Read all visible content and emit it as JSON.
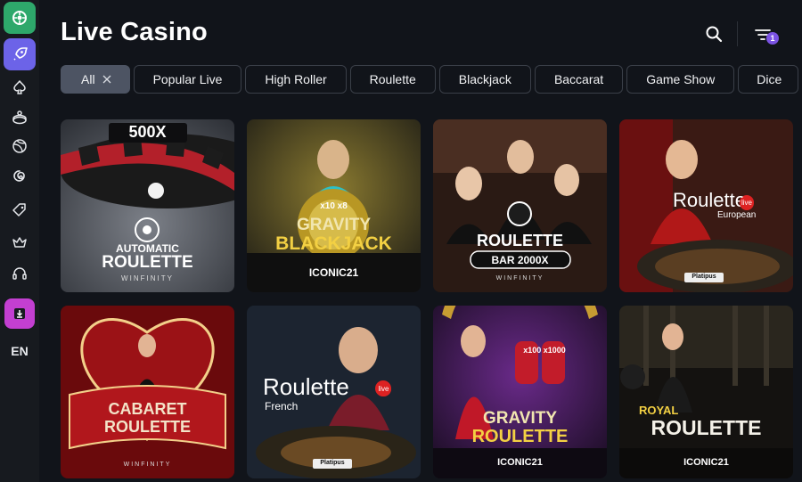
{
  "page": {
    "title": "Live Casino"
  },
  "header": {
    "filter_badge": "1"
  },
  "sidebar": {
    "items": [
      {
        "icon": "logo-icon"
      },
      {
        "icon": "rocket-icon"
      },
      {
        "icon": "spade-icon"
      },
      {
        "icon": "slot-machine-icon"
      },
      {
        "icon": "sports-ball-icon"
      },
      {
        "icon": "spiral-icon"
      },
      {
        "icon": "tag-icon"
      },
      {
        "icon": "crown-icon"
      },
      {
        "icon": "headset-icon"
      },
      {
        "icon": "download-icon"
      }
    ],
    "language": "EN"
  },
  "filters": [
    "All",
    "Popular Live",
    "High Roller",
    "Roulette",
    "Blackjack",
    "Baccarat",
    "Game Show",
    "Dice"
  ],
  "games": [
    {
      "top": "500X",
      "line1": "AUTOMATIC",
      "line2": "ROULETTE",
      "provider": "WINFINITY"
    },
    {
      "top": "x10  x8",
      "line1": "GRAVITY",
      "line2": "BLACKJACK",
      "provider": "ICONIC21"
    },
    {
      "line1": "ROULETTE",
      "line2": "BAR 2000X",
      "provider": "WINFINITY"
    },
    {
      "line1": "Roulette",
      "badge": "live",
      "line2": "European",
      "provider": "Platipus"
    },
    {
      "line1": "CABARET",
      "line2": "ROULETTE",
      "provider": "WINFINITY"
    },
    {
      "line1": "Roulette",
      "badge": "live",
      "line2": "French",
      "provider": "Platipus"
    },
    {
      "top": "x100  x1000",
      "line1": "GRAVITY",
      "line2": "ROULETTE",
      "provider": "ICONIC21"
    },
    {
      "line1": "ROYAL",
      "line2": "ROULETTE",
      "provider": "ICONIC21"
    }
  ],
  "colors": {
    "accent": "#7b53e3",
    "logo": "#2ea86b",
    "rocket": "#6c63e8",
    "download": "#c33fd1"
  }
}
